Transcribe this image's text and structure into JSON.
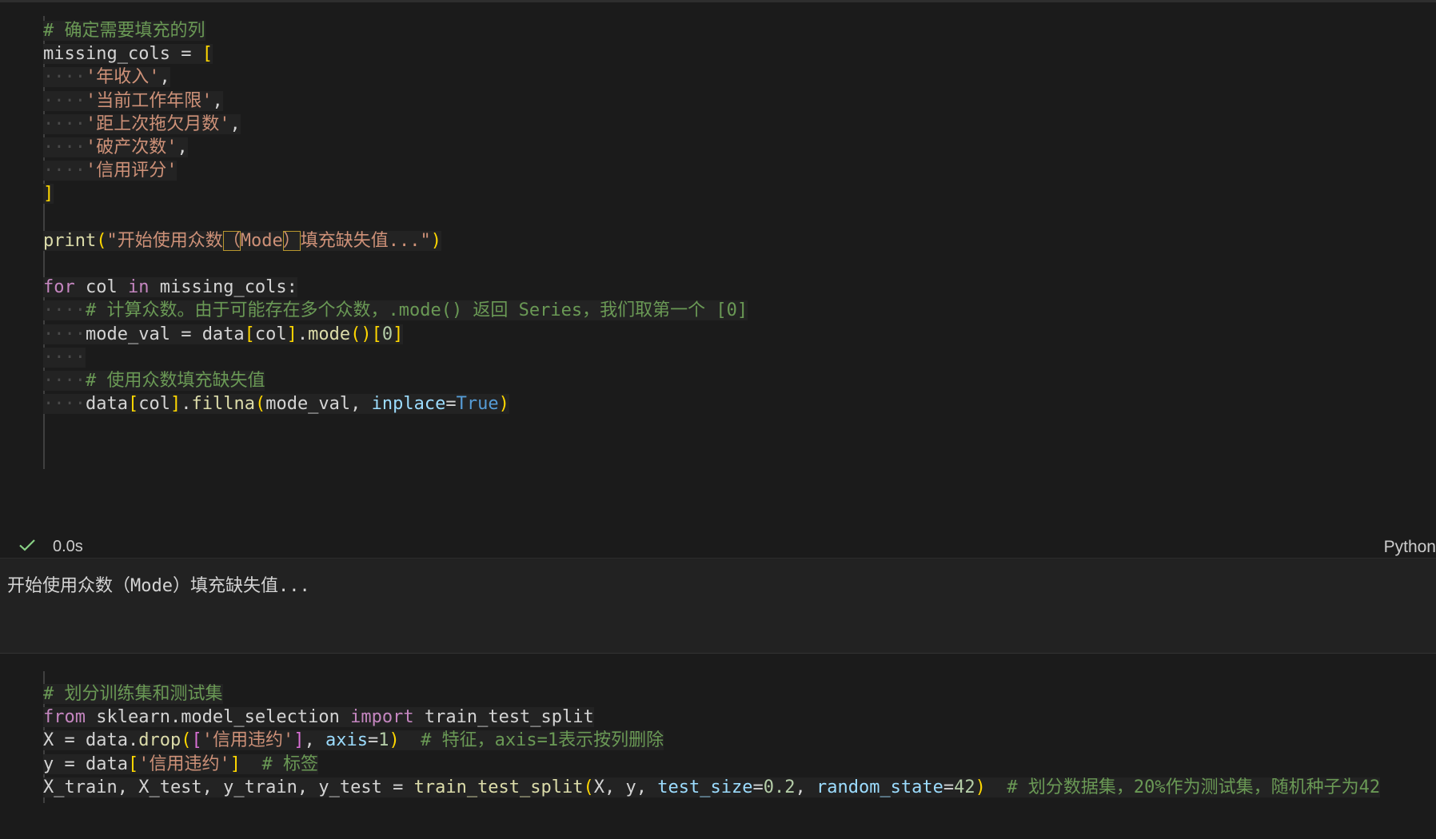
{
  "cell1": {
    "lines": [
      [
        {
          "t": "# 确定需要填充的列",
          "c": "com"
        }
      ],
      [
        {
          "t": "missing_cols",
          "c": "var"
        },
        {
          "t": " = ",
          "c": "var"
        },
        {
          "t": "[",
          "c": "br1"
        }
      ],
      [
        {
          "t": "····",
          "c": "ws"
        },
        {
          "t": "'年收入'",
          "c": "str"
        },
        {
          "t": ",",
          "c": "var"
        }
      ],
      [
        {
          "t": "····",
          "c": "ws"
        },
        {
          "t": "'当前工作年限'",
          "c": "str"
        },
        {
          "t": ",",
          "c": "var"
        }
      ],
      [
        {
          "t": "····",
          "c": "ws"
        },
        {
          "t": "'距上次拖欠月数'",
          "c": "str"
        },
        {
          "t": ",",
          "c": "var"
        }
      ],
      [
        {
          "t": "····",
          "c": "ws"
        },
        {
          "t": "'破产次数'",
          "c": "str"
        },
        {
          "t": ",",
          "c": "var"
        }
      ],
      [
        {
          "t": "····",
          "c": "ws"
        },
        {
          "t": "'信用评分'",
          "c": "str"
        }
      ],
      [
        {
          "t": "]",
          "c": "br1"
        }
      ],
      [],
      [
        {
          "t": "print",
          "c": "fn"
        },
        {
          "t": "(",
          "c": "br1"
        },
        {
          "t": "\"开始使用众数",
          "c": "str"
        },
        {
          "t": "（",
          "c": "str",
          "box": true
        },
        {
          "t": "Mode",
          "c": "str"
        },
        {
          "t": "）",
          "c": "str",
          "box": true
        },
        {
          "t": "填充缺失值...\"",
          "c": "str"
        },
        {
          "t": ")",
          "c": "br1"
        }
      ],
      [],
      [
        {
          "t": "for",
          "c": "kw"
        },
        {
          "t": " col ",
          "c": "var"
        },
        {
          "t": "in",
          "c": "kw"
        },
        {
          "t": " missing_cols:",
          "c": "var"
        }
      ],
      [
        {
          "t": "····",
          "c": "ws"
        },
        {
          "t": "# 计算众数。由于可能存在多个众数，.mode() 返回 Series，我们取第一个 [0]",
          "c": "com"
        }
      ],
      [
        {
          "t": "····",
          "c": "ws"
        },
        {
          "t": "mode_val",
          "c": "var"
        },
        {
          "t": " = data",
          "c": "var"
        },
        {
          "t": "[",
          "c": "br1"
        },
        {
          "t": "col",
          "c": "var"
        },
        {
          "t": "]",
          "c": "br1"
        },
        {
          "t": ".",
          "c": "var"
        },
        {
          "t": "mode",
          "c": "fn"
        },
        {
          "t": "()",
          "c": "br1"
        },
        {
          "t": "[",
          "c": "br1"
        },
        {
          "t": "0",
          "c": "num"
        },
        {
          "t": "]",
          "c": "br1"
        }
      ],
      [
        {
          "t": "····",
          "c": "ws"
        }
      ],
      [
        {
          "t": "····",
          "c": "ws"
        },
        {
          "t": "# 使用众数填充缺失值",
          "c": "com"
        }
      ],
      [
        {
          "t": "····",
          "c": "ws"
        },
        {
          "t": "data",
          "c": "var"
        },
        {
          "t": "[",
          "c": "br1"
        },
        {
          "t": "col",
          "c": "var"
        },
        {
          "t": "]",
          "c": "br1"
        },
        {
          "t": ".",
          "c": "var"
        },
        {
          "t": "fillna",
          "c": "fn"
        },
        {
          "t": "(",
          "c": "br1"
        },
        {
          "t": "mode_val, ",
          "c": "var"
        },
        {
          "t": "inplace",
          "c": "par"
        },
        {
          "t": "=",
          "c": "var"
        },
        {
          "t": "True",
          "c": "bool"
        },
        {
          "t": ")",
          "c": "br1"
        }
      ]
    ]
  },
  "status": {
    "icon": "check-icon",
    "time": "0.0s",
    "language": "Python"
  },
  "output": {
    "text": "开始使用众数（Mode）填充缺失值..."
  },
  "cell2": {
    "lines": [
      [
        {
          "t": "# 划分训练集和测试集",
          "c": "com"
        }
      ],
      [
        {
          "t": "from",
          "c": "kw"
        },
        {
          "t": " sklearn.model_selection ",
          "c": "var"
        },
        {
          "t": "import",
          "c": "kw"
        },
        {
          "t": " train_test_split",
          "c": "var"
        }
      ],
      [
        {
          "t": "X = data.",
          "c": "var"
        },
        {
          "t": "drop",
          "c": "fn"
        },
        {
          "t": "(",
          "c": "br1"
        },
        {
          "t": "[",
          "c": "br2"
        },
        {
          "t": "'信用违约'",
          "c": "str"
        },
        {
          "t": "]",
          "c": "br2"
        },
        {
          "t": ", ",
          "c": "var"
        },
        {
          "t": "axis",
          "c": "par"
        },
        {
          "t": "=",
          "c": "var"
        },
        {
          "t": "1",
          "c": "num"
        },
        {
          "t": ")",
          "c": "br1"
        },
        {
          "t": "  # 特征，axis=1表示按列删除",
          "c": "com"
        }
      ],
      [
        {
          "t": "y = data",
          "c": "var"
        },
        {
          "t": "[",
          "c": "br1"
        },
        {
          "t": "'信用违约'",
          "c": "str"
        },
        {
          "t": "]",
          "c": "br1"
        },
        {
          "t": "  # 标签",
          "c": "com"
        }
      ],
      [
        {
          "t": "X_train, X_test, y_train, y_test = ",
          "c": "var"
        },
        {
          "t": "train_test_split",
          "c": "fn"
        },
        {
          "t": "(",
          "c": "br1"
        },
        {
          "t": "X, y, ",
          "c": "var"
        },
        {
          "t": "test_size",
          "c": "par"
        },
        {
          "t": "=",
          "c": "var"
        },
        {
          "t": "0.2",
          "c": "num"
        },
        {
          "t": ", ",
          "c": "var"
        },
        {
          "t": "random_state",
          "c": "par"
        },
        {
          "t": "=",
          "c": "var"
        },
        {
          "t": "42",
          "c": "num"
        },
        {
          "t": ")",
          "c": "br1"
        },
        {
          "t": "  # 划分数据集，20%作为测试集，随机种子为42",
          "c": "com"
        }
      ]
    ]
  },
  "colors": {
    "background": "#1b1b1b",
    "comment": "#6a9955",
    "keyword": "#c586c0",
    "string": "#ce9178",
    "function": "#dcdcaa",
    "param": "#9cdcfe",
    "number": "#b5cea8",
    "bracket": "#ffd700",
    "boolean": "#569cd6"
  }
}
